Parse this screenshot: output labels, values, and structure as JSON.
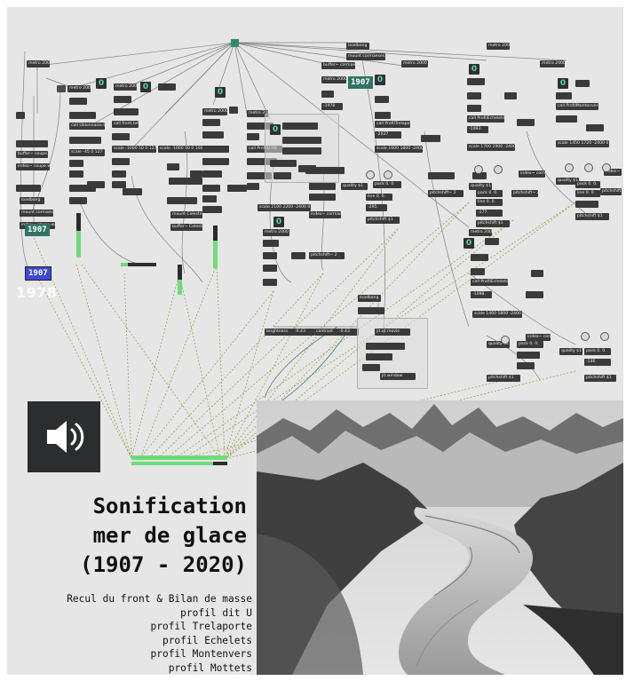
{
  "patch": {
    "year_display_1907": "1907",
    "year_display_blue": "1907",
    "year_label": "1978",
    "year_display_right": "1907",
    "toggles": [
      "0",
      "0",
      "0",
      "0",
      "0",
      "0",
      "0",
      "0",
      "0"
    ],
    "objects": [
      "loadbang",
      "metro 2000",
      "metro 2000",
      "metro 2000",
      "metro 2000",
      "metro 2000",
      "metro 2000",
      "buffer~ coupe.wav",
      "buffer~ cormaeses.wav",
      "mount cormaeses.wav",
      "index~ coupe.wav",
      "index~ cormaeses",
      "call Ublonnaise.txt",
      "call front.txt",
      "call ProfilU.txt",
      "call ProfilTrelaporte",
      "call ProfilEchelets",
      "call ProfilMontenvers",
      "scale -45 0 127",
      "scale -1000 50 0 127",
      "scale -1000 50 0 10000",
      "scale 45 0 127",
      "scale 2100 2200 -2400 0",
      "scale 1600 1800 -2400 0",
      "scale 1700 1900 -2400 0",
      "scale 1450 1720 -2400 0",
      "scale 1460 1800 -2400 0",
      "quality $1",
      "quality $1",
      "quality $1",
      "quality $1",
      "pack 0. 0.",
      "pack 0. 0.",
      "pack 0. 0.",
      "pack 0. 0.",
      "line 0. 0.",
      "line 0. 0.",
      "line 0. 0.",
      "pitchshift~ 2",
      "pitchshift~ 2",
      "pitchshift~ 2",
      "pitchshift~ 2",
      "pitchshift $1",
      "pitchshift $1",
      "pitchshift $1",
      "pitchshift $1",
      "index~ coupe.wav",
      "mount Celeste.aif",
      "buffer~ Celeste.aif",
      "index~ Celeste.aif",
      "brightness",
      "contrast",
      "jit.qt.movie",
      "jit.window",
      "loadbang",
      "counter",
      "groove~",
      "cycle~",
      "ezdac~"
    ],
    "numbers": [
      "-1978",
      "-2037",
      "-295.",
      "-1093.",
      "-1098.",
      "-177.",
      "-146.",
      "-0.43",
      "-0.43",
      "-5304.",
      "-7144.",
      "1.",
      "5.",
      "-62.",
      "-1978"
    ]
  },
  "speaker": {
    "icon": "speaker-icon"
  },
  "title_lines": [
    "Sonification",
    "mer de glace",
    "(1907 - 2020)"
  ],
  "subtitle_lines": [
    "Recul du front & Bilan de masse",
    "profil dit U",
    "profil Trelaporte",
    "profil Echelets",
    "profil Montenvers",
    "profil Mottets"
  ],
  "photo": {
    "alt": "black and white aerial photograph of the Mer de Glace glacier between mountain ridges"
  },
  "colors": {
    "canvas": "#e6e6e6",
    "object": "#3a3a3a",
    "patchcord": "#9aa34a",
    "meter": "#6fdc7a",
    "accent": "#4fd9b9",
    "blue_number": "#3f49d6"
  }
}
